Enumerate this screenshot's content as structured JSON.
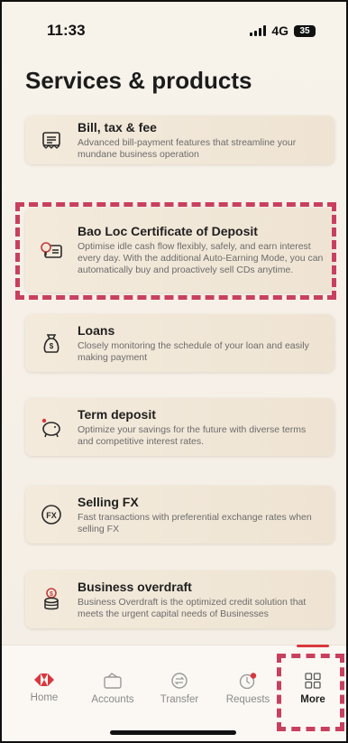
{
  "status_bar": {
    "time": "11:33",
    "network": "4G",
    "battery": "35"
  },
  "page": {
    "title": "Services & products"
  },
  "services": [
    {
      "title": "Bill, tax & fee",
      "description": "Advanced bill-payment features that streamline your mundane business operation",
      "icon": "receipt-icon"
    },
    {
      "title": "Bao Loc Certificate of Deposit",
      "description": "Optimise idle cash flow flexibly, safely, and earn interest every day. With the additional Auto-Earning Mode, you can automatically buy and proactively sell CDs anytime.",
      "icon": "certificate-icon"
    },
    {
      "title": "Loans",
      "description": "Closely monitoring the schedule of your loan and easily making payment",
      "icon": "money-bag-icon"
    },
    {
      "title": "Term deposit",
      "description": "Optimize your savings for the future with diverse terms and competitive interest rates.",
      "icon": "piggy-bank-icon"
    },
    {
      "title": "Selling FX",
      "description": "Fast transactions with preferential exchange rates when selling FX",
      "icon": "fx-icon"
    },
    {
      "title": "Business overdraft",
      "description": "Business Overdraft is the optimized credit solution that meets the urgent capital needs of Businesses",
      "icon": "coin-stack-icon"
    }
  ],
  "bottom_nav": {
    "items": [
      {
        "label": "Home",
        "icon": "home-logo-icon"
      },
      {
        "label": "Accounts",
        "icon": "wallet-icon"
      },
      {
        "label": "Transfer",
        "icon": "transfer-icon"
      },
      {
        "label": "Requests",
        "icon": "requests-icon"
      },
      {
        "label": "More",
        "icon": "grid-icon"
      }
    ],
    "active": "More"
  },
  "colors": {
    "brand_red": "#d9373e",
    "highlight_dash": "#c9405e",
    "card_bg": "#f0e6d6"
  }
}
